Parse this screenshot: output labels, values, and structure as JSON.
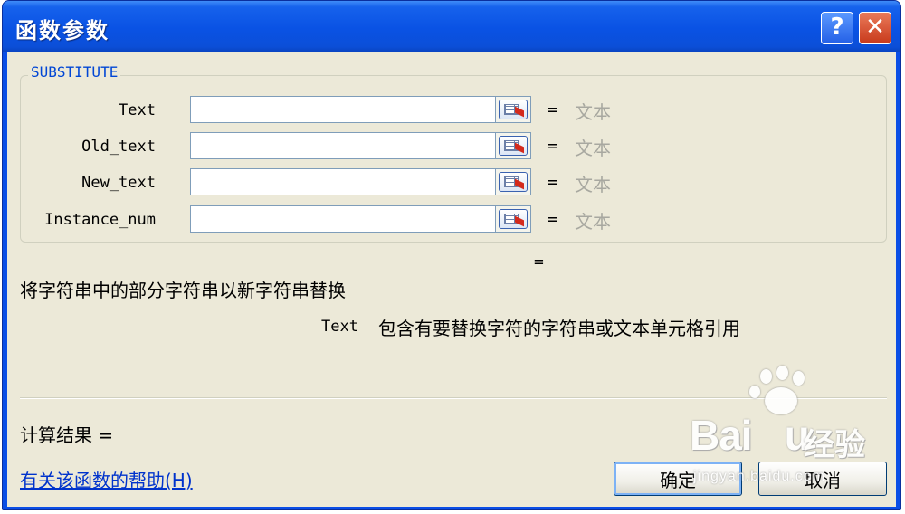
{
  "window": {
    "title": "函数参数",
    "help_button": "?",
    "close_button": "✕"
  },
  "function": {
    "name": "SUBSTITUTE",
    "args": [
      {
        "label": "Text",
        "value": "",
        "hint": "文本"
      },
      {
        "label": "Old_text",
        "value": "",
        "hint": "文本"
      },
      {
        "label": "New_text",
        "value": "",
        "hint": "文本"
      },
      {
        "label": "Instance_num",
        "value": "",
        "hint": "文本"
      }
    ],
    "equals": "=",
    "result_equals": "=",
    "description": "将字符串中的部分字符串以新字符串替换",
    "arg_desc_name": "Text",
    "arg_desc_text": "包含有要替换字符的字符串或文本单元格引用"
  },
  "footer": {
    "result_label": "计算结果 =",
    "help_link": "有关该函数的帮助(H)",
    "ok_label": "确定",
    "cancel_label": "取消"
  },
  "watermark": {
    "brand": "Bai",
    "brand_end": "u",
    "brand_cn": "经验",
    "url": "jingyan.baidu.com"
  },
  "colors": {
    "titlebar": "#0a52e4",
    "client_bg": "#ece9d8",
    "group_title": "#0046d5",
    "hint": "#a8a8a0",
    "link": "#0033cc"
  }
}
